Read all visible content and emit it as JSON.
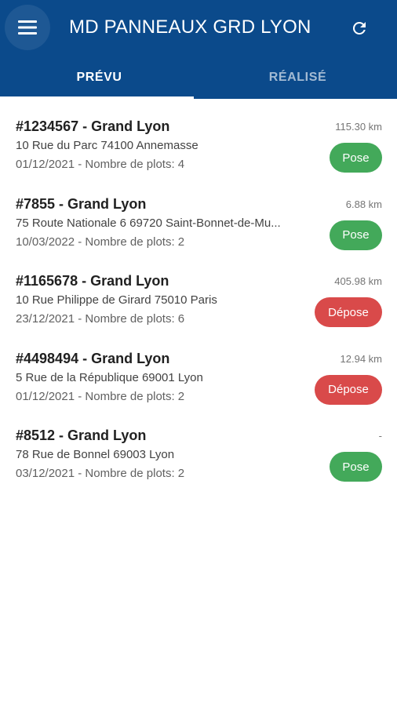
{
  "header": {
    "title": "MD PANNEAUX GRD LYON",
    "menu_icon": "menu-icon",
    "refresh_icon": "refresh-icon",
    "background_color": "#0b4a8b"
  },
  "tabs": [
    {
      "label": "PRÉVU",
      "active": true
    },
    {
      "label": "RÉALISÉ",
      "active": false
    }
  ],
  "status_colors": {
    "Pose": "#43a95a",
    "Dépose": "#d94a4a"
  },
  "items": [
    {
      "title": "#1234567 - Grand Lyon",
      "address": "10 Rue du Parc 74100 Annemasse",
      "details": "01/12/2021 - Nombre de plots: 4",
      "distance": "115.30 km",
      "status": "Pose",
      "status_type": "pose"
    },
    {
      "title": "#7855 - Grand Lyon",
      "address": "75 Route Nationale 6 69720 Saint-Bonnet-de-Mu...",
      "details": "10/03/2022 - Nombre de plots: 2",
      "distance": "6.88 km",
      "status": "Pose",
      "status_type": "pose"
    },
    {
      "title": "#1165678 - Grand Lyon",
      "address": "10 Rue Philippe de Girard 75010 Paris",
      "details": "23/12/2021 - Nombre de plots: 6",
      "distance": "405.98 km",
      "status": "Dépose",
      "status_type": "depose"
    },
    {
      "title": "#4498494 - Grand Lyon",
      "address": "5 Rue de la République 69001 Lyon",
      "details": "01/12/2021 - Nombre de plots: 2",
      "distance": "12.94 km",
      "status": "Dépose",
      "status_type": "depose"
    },
    {
      "title": "#8512 - Grand Lyon",
      "address": "78 Rue de Bonnel 69003 Lyon",
      "details": "03/12/2021 - Nombre de plots: 2",
      "distance": "-",
      "status": "Pose",
      "status_type": "pose"
    }
  ]
}
